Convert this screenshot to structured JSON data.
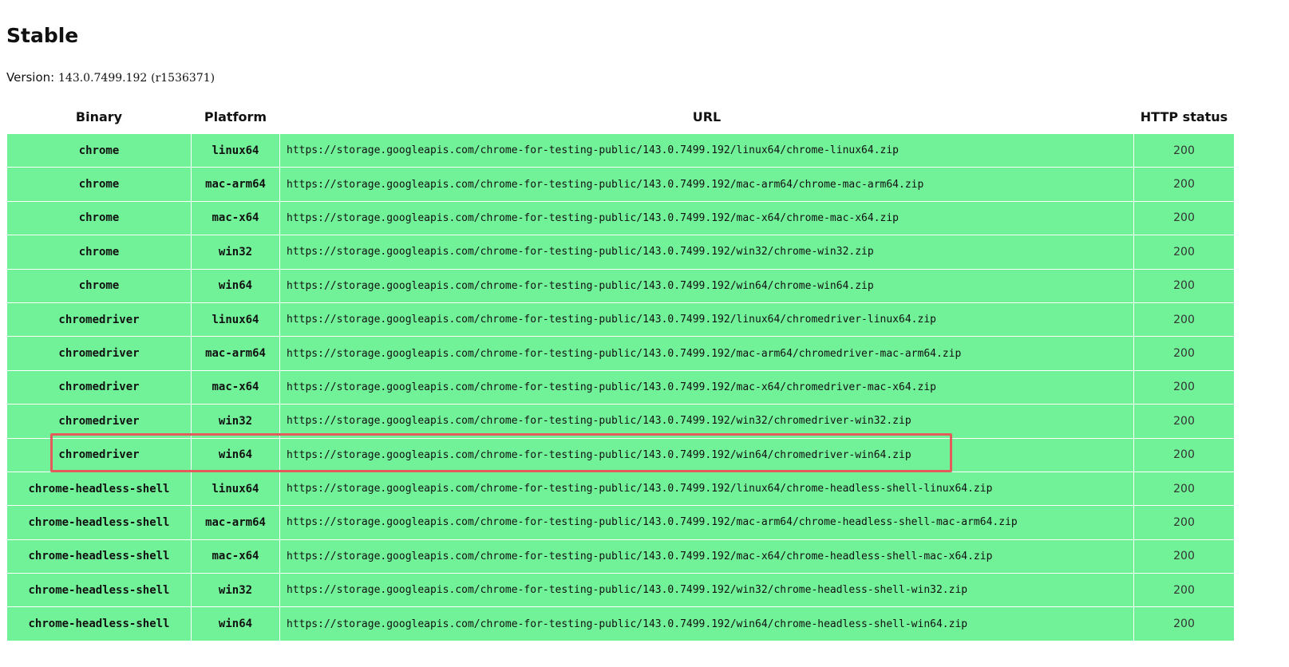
{
  "section": {
    "title": "Stable",
    "version_label": "Version:",
    "version_value": "143.0.7499.192",
    "revision": "(r1536371)"
  },
  "table": {
    "headers": {
      "binary": "Binary",
      "platform": "Platform",
      "url": "URL",
      "status": "HTTP status"
    },
    "rows": [
      {
        "binary": "chrome",
        "platform": "linux64",
        "url": "https://storage.googleapis.com/chrome-for-testing-public/143.0.7499.192/linux64/chrome-linux64.zip",
        "status": "200"
      },
      {
        "binary": "chrome",
        "platform": "mac-arm64",
        "url": "https://storage.googleapis.com/chrome-for-testing-public/143.0.7499.192/mac-arm64/chrome-mac-arm64.zip",
        "status": "200"
      },
      {
        "binary": "chrome",
        "platform": "mac-x64",
        "url": "https://storage.googleapis.com/chrome-for-testing-public/143.0.7499.192/mac-x64/chrome-mac-x64.zip",
        "status": "200"
      },
      {
        "binary": "chrome",
        "platform": "win32",
        "url": "https://storage.googleapis.com/chrome-for-testing-public/143.0.7499.192/win32/chrome-win32.zip",
        "status": "200"
      },
      {
        "binary": "chrome",
        "platform": "win64",
        "url": "https://storage.googleapis.com/chrome-for-testing-public/143.0.7499.192/win64/chrome-win64.zip",
        "status": "200"
      },
      {
        "binary": "chromedriver",
        "platform": "linux64",
        "url": "https://storage.googleapis.com/chrome-for-testing-public/143.0.7499.192/linux64/chromedriver-linux64.zip",
        "status": "200"
      },
      {
        "binary": "chromedriver",
        "platform": "mac-arm64",
        "url": "https://storage.googleapis.com/chrome-for-testing-public/143.0.7499.192/mac-arm64/chromedriver-mac-arm64.zip",
        "status": "200"
      },
      {
        "binary": "chromedriver",
        "platform": "mac-x64",
        "url": "https://storage.googleapis.com/chrome-for-testing-public/143.0.7499.192/mac-x64/chromedriver-mac-x64.zip",
        "status": "200"
      },
      {
        "binary": "chromedriver",
        "platform": "win32",
        "url": "https://storage.googleapis.com/chrome-for-testing-public/143.0.7499.192/win32/chromedriver-win32.zip",
        "status": "200"
      },
      {
        "binary": "chromedriver",
        "platform": "win64",
        "url": "https://storage.googleapis.com/chrome-for-testing-public/143.0.7499.192/win64/chromedriver-win64.zip",
        "status": "200"
      },
      {
        "binary": "chrome-headless-shell",
        "platform": "linux64",
        "url": "https://storage.googleapis.com/chrome-for-testing-public/143.0.7499.192/linux64/chrome-headless-shell-linux64.zip",
        "status": "200"
      },
      {
        "binary": "chrome-headless-shell",
        "platform": "mac-arm64",
        "url": "https://storage.googleapis.com/chrome-for-testing-public/143.0.7499.192/mac-arm64/chrome-headless-shell-mac-arm64.zip",
        "status": "200"
      },
      {
        "binary": "chrome-headless-shell",
        "platform": "mac-x64",
        "url": "https://storage.googleapis.com/chrome-for-testing-public/143.0.7499.192/mac-x64/chrome-headless-shell-mac-x64.zip",
        "status": "200"
      },
      {
        "binary": "chrome-headless-shell",
        "platform": "win32",
        "url": "https://storage.googleapis.com/chrome-for-testing-public/143.0.7499.192/win32/chrome-headless-shell-win32.zip",
        "status": "200"
      },
      {
        "binary": "chrome-headless-shell",
        "platform": "win64",
        "url": "https://storage.googleapis.com/chrome-for-testing-public/143.0.7499.192/win64/chrome-headless-shell-win64.zip",
        "status": "200"
      }
    ]
  },
  "colors": {
    "row_ok": "#71f198",
    "highlight": "#e35b5b"
  }
}
